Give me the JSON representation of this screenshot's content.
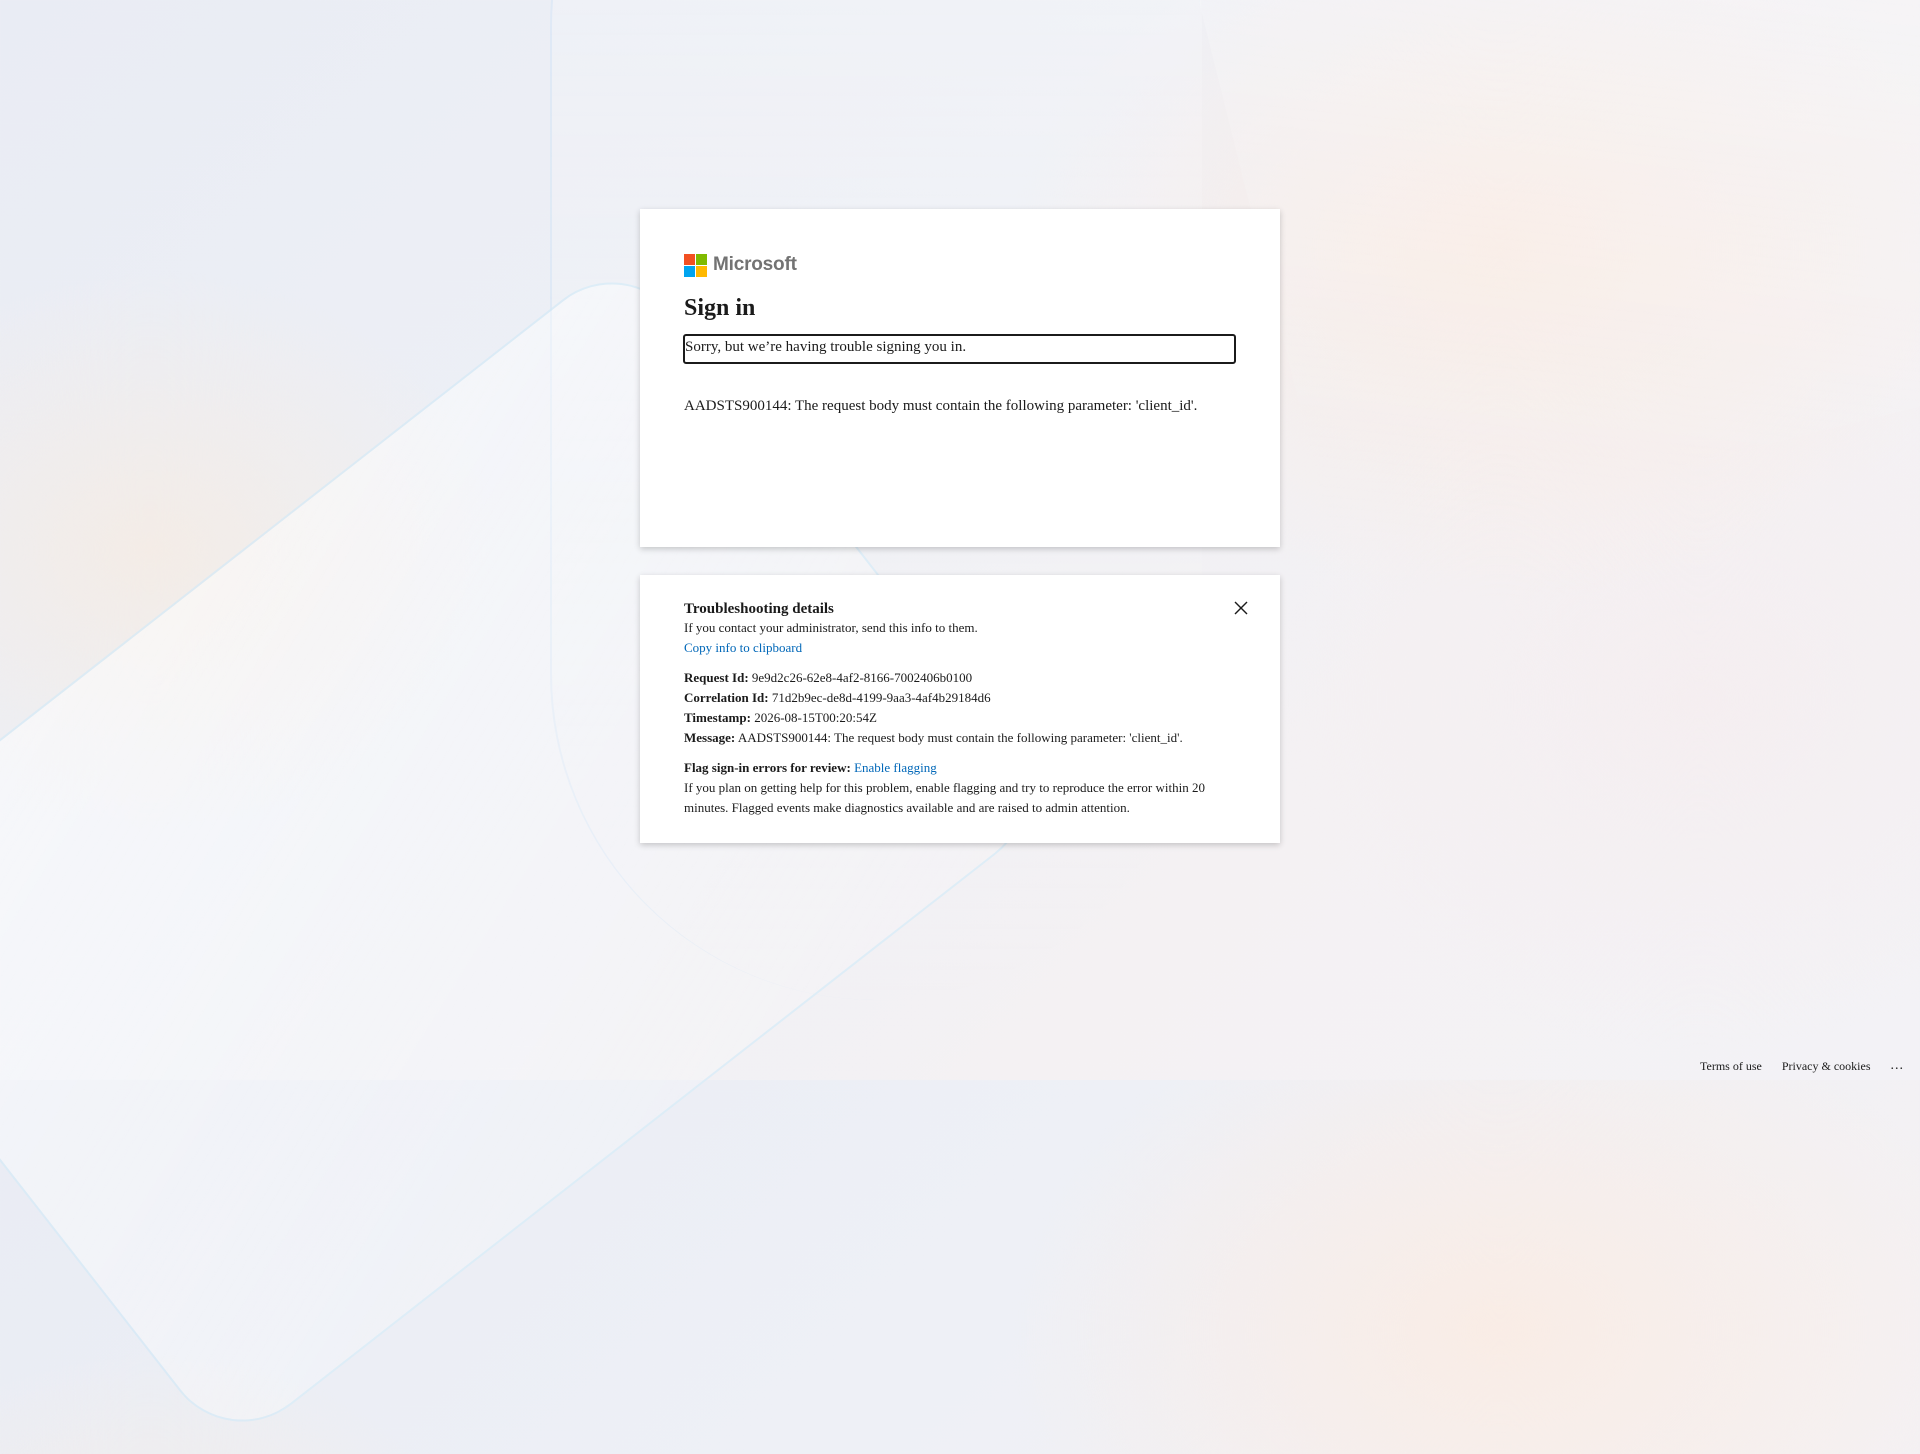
{
  "brand": {
    "name": "Microsoft"
  },
  "signin": {
    "title": "Sign in",
    "error_message": "Sorry, but we’re having trouble signing you in.",
    "error_detail": "AADSTS900144: The request body must contain the following parameter: 'client_id'."
  },
  "troubleshooting": {
    "title": "Troubleshooting details",
    "contact_text": "If you contact your administrator, send this info to them.",
    "copy_link": "Copy info to clipboard",
    "request_id_label": "Request Id:",
    "request_id": "9e9d2c26-62e8-4af2-8166-7002406b0100",
    "correlation_id_label": "Correlation Id:",
    "correlation_id": "71d2b9ec-de8d-4199-9aa3-4af4b29184d6",
    "timestamp_label": "Timestamp:",
    "timestamp": "2026-08-15T00:20:54Z",
    "message_label": "Message:",
    "message": "AADSTS900144: The request body must contain the following parameter: 'client_id'.",
    "flag_label": "Flag sign-in errors for review:",
    "flag_link": "Enable flagging",
    "flag_description": "If you plan on getting help for this problem, enable flagging and try to reproduce the error within 20 minutes. Flagged events make diagnostics available and are raised to admin attention."
  },
  "footer": {
    "terms": "Terms of use",
    "privacy": "Privacy & cookies",
    "more": "..."
  },
  "icons": {
    "logo": "microsoft-logo-icon",
    "close": "close-icon"
  },
  "colors": {
    "link": "#0067b8",
    "text": "#1b1b1b",
    "logo_red": "#f25022",
    "logo_green": "#7fba00",
    "logo_blue": "#00a4ef",
    "logo_yellow": "#ffb900"
  }
}
